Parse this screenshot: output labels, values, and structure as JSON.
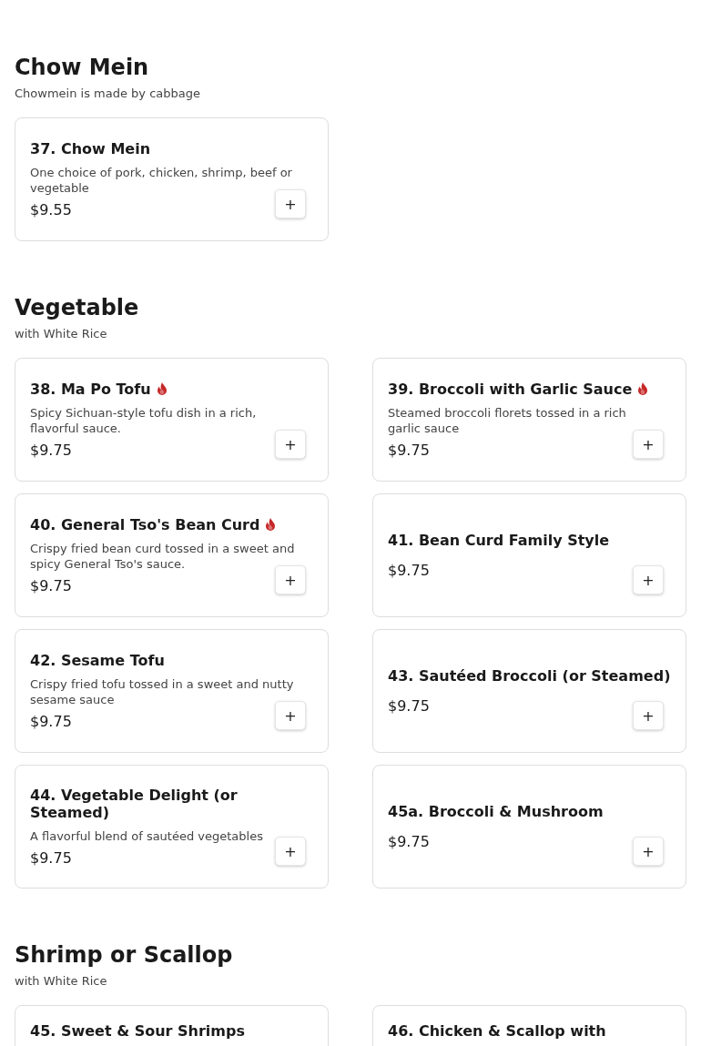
{
  "sections": [
    {
      "title": "Chow Mein",
      "subtitle": "Chowmein is made by cabbage",
      "items": [
        {
          "name": "37. Chow Mein",
          "spicy": false,
          "description": "One choice of pork, chicken, shrimp, beef or vegetable",
          "price": "$9.55",
          "button": "+"
        }
      ]
    },
    {
      "title": "Vegetable",
      "subtitle": "with White Rice",
      "items": [
        {
          "name": "38. Ma Po Tofu",
          "spicy": true,
          "description": "Spicy Sichuan-style tofu dish in a rich, flavorful sauce.",
          "price": "$9.75",
          "button": "+"
        },
        {
          "name": "39. Broccoli with Garlic Sauce",
          "spicy": true,
          "description": "Steamed broccoli florets tossed in a rich garlic sauce",
          "price": "$9.75",
          "button": "+"
        },
        {
          "name": "40. General Tso's Bean Curd",
          "spicy": true,
          "description": "Crispy fried bean curd tossed in a sweet and spicy General Tso's sauce.",
          "price": "$9.75",
          "button": "+"
        },
        {
          "name": "41. Bean Curd Family Style",
          "spicy": false,
          "price": "$9.75",
          "button": "+"
        },
        {
          "name": "42. Sesame Tofu",
          "spicy": false,
          "description": "Crispy fried tofu tossed in a sweet and nutty sesame sauce",
          "price": "$9.75",
          "button": "+"
        },
        {
          "name": "43. Sautéed Broccoli (or Steamed)",
          "spicy": false,
          "price": "$9.75",
          "button": "+"
        },
        {
          "name": "44. Vegetable Delight (or Steamed)",
          "spicy": false,
          "description": "A flavorful blend of sautéed vegetables",
          "price": "$9.75",
          "button": "+"
        },
        {
          "name": "45a. Broccoli & Mushroom",
          "spicy": false,
          "price": "$9.75",
          "button": "+"
        }
      ]
    },
    {
      "title": "Shrimp or Scallop",
      "subtitle": "with White Rice",
      "items": [
        {
          "name": "45. Sweet & Sour Shrimps",
          "spicy": false
        },
        {
          "name": "46. Chicken & Scallop with",
          "spicy": false
        }
      ]
    }
  ]
}
